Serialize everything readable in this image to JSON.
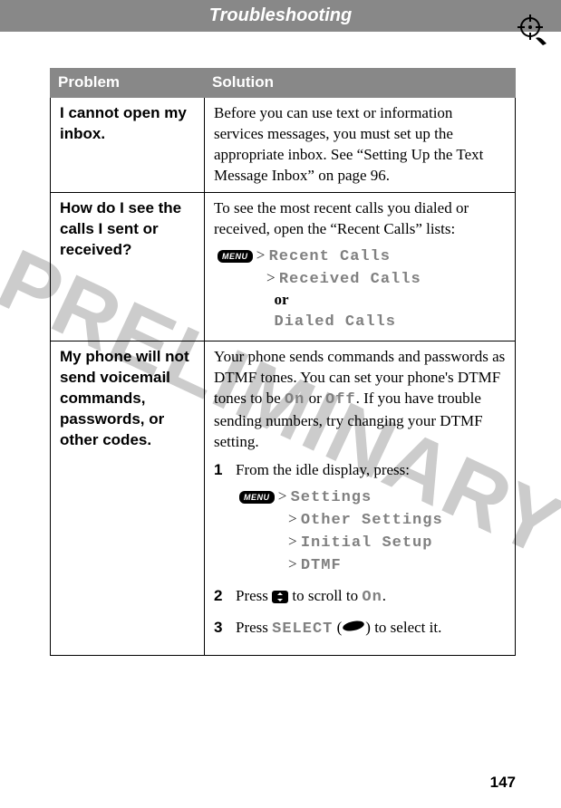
{
  "watermark": "PRELIMINARY",
  "header": {
    "title": "Troubleshooting"
  },
  "table": {
    "headers": {
      "problem": "Problem",
      "solution": "Solution"
    },
    "row1": {
      "problem": "I cannot open my inbox.",
      "solution": "Before you can use text or information services messages, you must set up the appropriate inbox. See “Setting Up the Text Message Inbox” on page 96."
    },
    "row2": {
      "problem": "How do I see the calls I sent or received?",
      "solution_intro": "To see the most recent calls you dialed or received, open the “Recent Calls” lists:",
      "menu_label": "MENU",
      "nav1": "Recent Calls",
      "nav2": "Received Calls",
      "or": "or",
      "nav3": "Dialed Calls"
    },
    "row3": {
      "problem": "My phone will not send voicemail commands, passwords, or other codes.",
      "solution_intro_a": "Your phone sends commands and passwords as DTMF tones. You can set your phone's DTMF tones to be ",
      "on": "On",
      "solution_intro_b": " or ",
      "off": "Off",
      "solution_intro_c": ". If you have trouble sending numbers, try changing your DTMF setting.",
      "step1_text": "From the idle display, press:",
      "menu_label": "MENU",
      "s1": "Settings",
      "s2": "Other Settings",
      "s3": "Initial Setup",
      "s4": "DTMF",
      "step2_a": "Press ",
      "step2_b": " to scroll to ",
      "step2_on": "On",
      "step2_c": ".",
      "step3_a": "Press ",
      "step3_select": "SELECT",
      "step3_b": " (",
      "step3_c": ") to select it."
    }
  },
  "keys": {
    "menu": "MENU"
  },
  "page_number": "147"
}
